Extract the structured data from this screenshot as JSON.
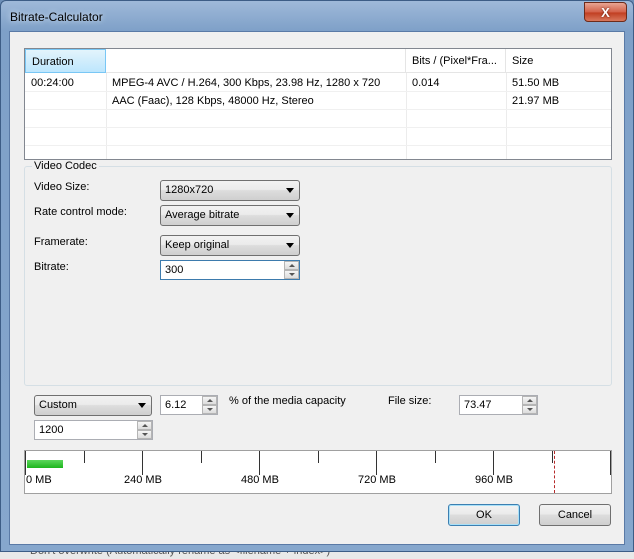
{
  "window": {
    "title": "Bitrate-Calculator",
    "close_glyph": "X"
  },
  "table": {
    "columns": [
      "Duration",
      "",
      "Bits / (Pixel*Fra...",
      "Size"
    ],
    "rows": [
      {
        "duration": "00:24:00",
        "description": "MPEG-4 AVC / H.264, 300 Kbps, 23.98 Hz, 1280 x 720",
        "bits": "0.014",
        "size": "51.50 MB"
      },
      {
        "duration": "",
        "description": "AAC (Faac), 128 Kbps, 48000 Hz, Stereo",
        "bits": "",
        "size": "21.97 MB"
      }
    ]
  },
  "video_codec": {
    "legend": "Video Codec",
    "video_size_label": "Video Size:",
    "video_size_value": "1280x720",
    "rate_control_label": "Rate control mode:",
    "rate_control_value": "Average bitrate",
    "framerate_label": "Framerate:",
    "framerate_value": "Keep original",
    "bitrate_label": "Bitrate:",
    "bitrate_value": "300"
  },
  "media": {
    "preset_value": "Custom",
    "percent_value": "6.12",
    "percent_label": "% of the media capacity",
    "file_size_label": "File size:",
    "file_size_value": "73.47",
    "capacity_value": "1200"
  },
  "ruler": {
    "max_mb": 1200,
    "file_size_mb": 73.47,
    "limit_mb": 1200,
    "major_ticks": [
      "0 MB",
      "240 MB",
      "480 MB",
      "720 MB",
      "960 MB"
    ],
    "bar_color": "#1db51d"
  },
  "buttons": {
    "ok": "OK",
    "cancel": "Cancel"
  },
  "background": {
    "text": "Don't overwrite (Automatically rename as <filename + index>)"
  }
}
